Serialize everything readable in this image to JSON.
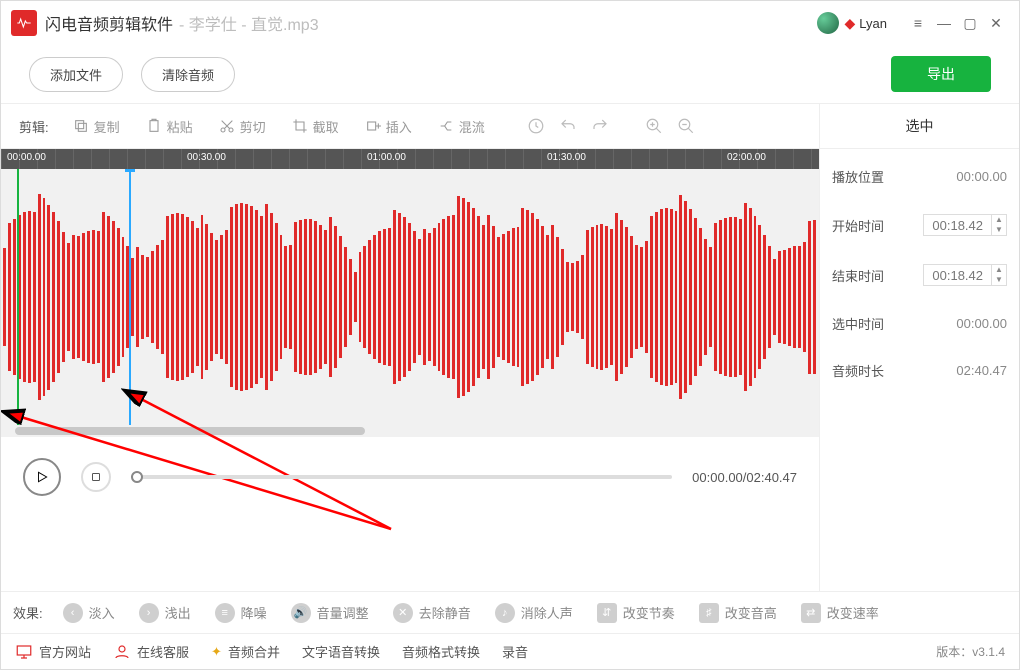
{
  "title_bar": {
    "app_name": "闪电音频剪辑软件",
    "file_name": "李学仕 - 直觉.mp3",
    "user_name": "Lyan"
  },
  "actions": {
    "add_file": "添加文件",
    "clear_audio": "清除音频",
    "export": "导出"
  },
  "toolbar": {
    "label": "剪辑:",
    "copy": "复制",
    "paste": "粘贴",
    "cut": "剪切",
    "crop": "截取",
    "insert": "插入",
    "mix": "混流"
  },
  "right_panel": {
    "header": "选中",
    "play_pos_label": "播放位置",
    "play_pos": "00:00.00",
    "start_label": "开始时间",
    "start": "00:18.42",
    "end_label": "结束时间",
    "end": "00:18.42",
    "sel_dur_label": "选中时间",
    "sel_dur": "00:00.00",
    "total_label": "音频时长",
    "total": "02:40.47"
  },
  "ruler": {
    "t0": "00:00.00",
    "t1": "00:30.00",
    "t2": "01:00.00",
    "t3": "01:30.00",
    "t4": "02:00.00"
  },
  "playback": {
    "time": "00:00.00/02:40.47"
  },
  "effects": {
    "label": "效果:",
    "fade_in": "淡入",
    "fade_out": "浅出",
    "denoise": "降噪",
    "volume": "音量调整",
    "trim_silence": "去除静音",
    "remove_vocal": "消除人声",
    "tempo": "改变节奏",
    "pitch": "改变音高",
    "speed": "改变速率"
  },
  "footer": {
    "site": "官方网站",
    "support": "在线客服",
    "merge": "音频合并",
    "tts": "文字语音转换",
    "format": "音频格式转换",
    "record": "录音",
    "version": "版本：v3.1.4"
  }
}
